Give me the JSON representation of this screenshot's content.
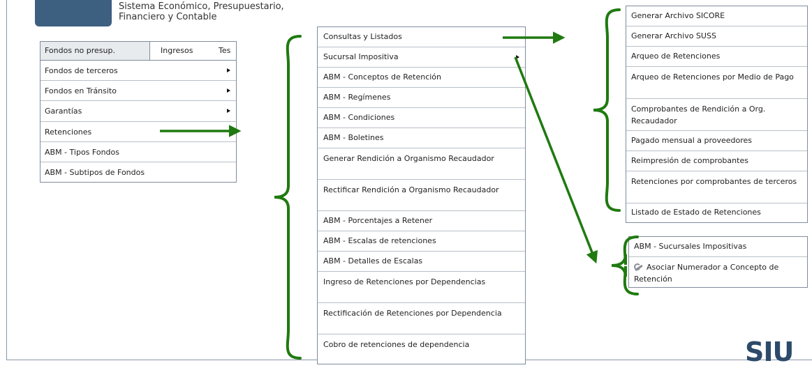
{
  "header": {
    "system_name_line1": "Sistema Económico, Presupuestario,",
    "system_name_line2": "Financiero y Contable"
  },
  "top_menu": {
    "tabs": [
      "Fondos no presup.",
      "Ingresos",
      "Tes"
    ]
  },
  "fondos_menu": {
    "items": [
      {
        "label": "Fondos de terceros",
        "submenu": true
      },
      {
        "label": "Fondos en Tránsito",
        "submenu": true
      },
      {
        "label": "Garantías",
        "submenu": true
      },
      {
        "label": "Retenciones",
        "submenu": false
      },
      {
        "label": "ABM - Tipos Fondos",
        "submenu": false
      },
      {
        "label": "ABM - Subtipos de Fondos",
        "submenu": false
      }
    ]
  },
  "retenciones_menu": {
    "items": [
      {
        "label": "Consultas y Listados"
      },
      {
        "label": "Sucursal Impositiva"
      },
      {
        "label": "ABM - Conceptos de Retención"
      },
      {
        "label": "ABM - Regímenes"
      },
      {
        "label": "ABM - Condiciones"
      },
      {
        "label": "ABM - Boletines"
      },
      {
        "label": "Generar Rendición a Organismo Recaudador"
      },
      {
        "label": "Rectificar Rendición a Organismo Recaudador"
      },
      {
        "label": "ABM - Porcentajes a Retener"
      },
      {
        "label": "ABM - Escalas de retenciones"
      },
      {
        "label": "ABM - Detalles de Escalas"
      },
      {
        "label": "Ingreso de Retenciones por Dependencias"
      },
      {
        "label": "Rectificación de Retenciones por Dependencia"
      },
      {
        "label": "Cobro de retenciones de dependencia"
      }
    ]
  },
  "consultas_menu": {
    "items": [
      {
        "label": "Generar Archivo SICORE"
      },
      {
        "label": "Generar Archivo SUSS"
      },
      {
        "label": "Arqueo de Retenciones"
      },
      {
        "label": "Arqueo de Retenciones por Medio de Pago"
      },
      {
        "label": "Comprobantes de Rendición a Org. Recaudador"
      },
      {
        "label": "Pagado mensual a proveedores"
      },
      {
        "label": "Reimpresión de comprobantes"
      },
      {
        "label": "Retenciones por comprobantes de terceros"
      },
      {
        "label": "Listado de Estado de Retenciones"
      }
    ]
  },
  "sucursal_menu": {
    "items": [
      {
        "label": "ABM - Sucursales Impositivas",
        "icon": ""
      },
      {
        "label": "Asociar Numerador a Concepto de Retención",
        "icon": "wrench-icon"
      }
    ]
  },
  "colors": {
    "annotation": "#1f7a0f",
    "menu_border": "#7f8c9c",
    "logo": "#2d4a6a"
  },
  "logo": {
    "text": "SIU"
  }
}
